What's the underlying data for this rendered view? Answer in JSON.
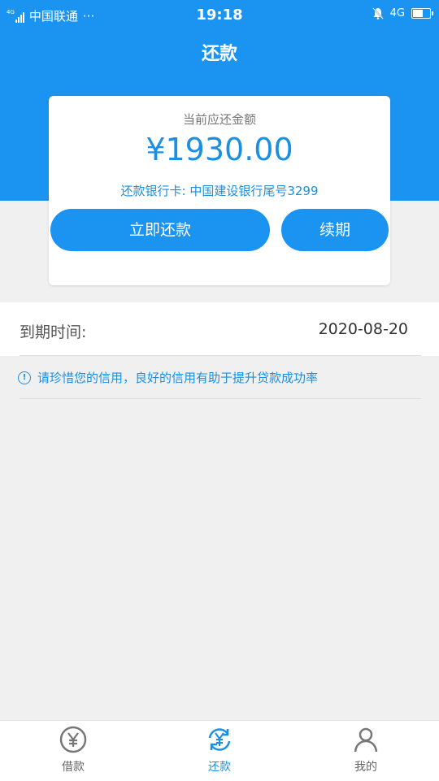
{
  "status_bar": {
    "carrier": "中国联通",
    "more": "···",
    "time": "19:18",
    "network": "4G",
    "signal_tag": "4G"
  },
  "header": {
    "title": "还款"
  },
  "card": {
    "amount_label": "当前应还金额",
    "amount": "¥1930.00",
    "bank_info": "还款银行卡: 中国建设银行尾号3299",
    "repay_button": "立即还款",
    "renew_button": "续期"
  },
  "due": {
    "label": "到期时间:",
    "value": "2020-08-20"
  },
  "tip": {
    "icon": "info-icon",
    "text": "请珍惜您的信用，良好的信用有助于提升贷款成功率"
  },
  "tabbar": {
    "items": [
      {
        "label": "借款",
        "icon": "yen-circle-icon",
        "active": false
      },
      {
        "label": "还款",
        "icon": "yen-refresh-icon",
        "active": true
      },
      {
        "label": "我的",
        "icon": "person-icon",
        "active": false
      }
    ]
  },
  "colors": {
    "primary": "#1b94f1",
    "accent_text": "#1b8fe0",
    "background": "#f0f0f0"
  }
}
